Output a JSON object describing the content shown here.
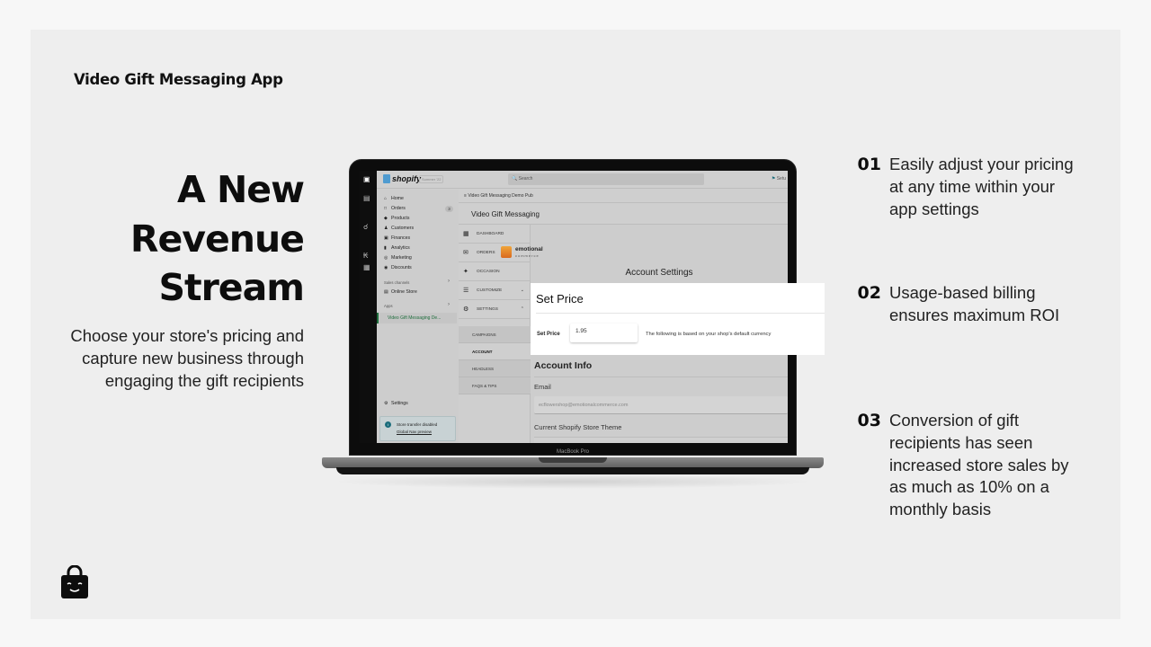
{
  "slide": {
    "app_title": "Video Gift Messaging App",
    "headline_lines": [
      "A New",
      "Revenue",
      "Stream"
    ],
    "subtext_lines": [
      "Choose your store's pricing and",
      "capture new business through",
      "engaging the gift recipients"
    ],
    "logo_icon": "smiling-shopping-bag-icon"
  },
  "features": [
    {
      "num": "01",
      "lines": [
        "Easily adjust your pricing",
        "at any time within your",
        "app settings"
      ]
    },
    {
      "num": "02",
      "lines": [
        "Usage-based billing",
        "ensures maximum ROI"
      ]
    },
    {
      "num": "03",
      "lines": [
        "Conversion of gift",
        "recipients has seen",
        "increased store sales by",
        "as much as 10% on a",
        "monthly basis"
      ]
    }
  ],
  "laptop": {
    "label": "MacBook Pro",
    "shopify": {
      "brand": "shopify",
      "edition_badge": "Summer '22",
      "search_placeholder": "Search",
      "setup_label": "Setu",
      "nav": [
        {
          "label": "Home",
          "icon": "home-icon"
        },
        {
          "label": "Orders",
          "icon": "orders-icon",
          "badge": "3"
        },
        {
          "label": "Products",
          "icon": "tag-icon"
        },
        {
          "label": "Customers",
          "icon": "person-icon"
        },
        {
          "label": "Finances",
          "icon": "bank-icon"
        },
        {
          "label": "Analytics",
          "icon": "bar-chart-icon"
        },
        {
          "label": "Marketing",
          "icon": "target-icon"
        },
        {
          "label": "Discounts",
          "icon": "discount-icon"
        }
      ],
      "sales_channels_label": "Sales channels",
      "online_store_label": "Online Store",
      "apps_label": "Apps",
      "active_app": "Video Gift Messaging De...",
      "settings_label": "Settings",
      "banner_line1": "Store transfer disabled",
      "banner_line2": "Global Nav preview",
      "breadcrumb": "Video Gift Messaging Demo Pub",
      "app_header": "Video Gift Messaging",
      "sub_nav": [
        {
          "label": "DASHBOARD",
          "icon": "dashboard-icon"
        },
        {
          "label": "ORDERS",
          "icon": "orders-box-icon"
        },
        {
          "label": "OCCASION",
          "icon": "party-icon"
        },
        {
          "label": "CUSTOMIZE",
          "icon": "sliders-icon",
          "chevron": "down"
        },
        {
          "label": "SETTINGS",
          "icon": "gear-icon",
          "chevron": "up"
        }
      ],
      "settings_children": [
        "CAMPAIGNS",
        "ACCOUNT",
        "HEADLESS",
        "FAQS & TIPS"
      ],
      "active_child": "ACCOUNT",
      "brand_logo_top": "emotional",
      "brand_logo_bottom": "commerce",
      "account_settings_title": "Account Settings",
      "account_info_title": "Account Info",
      "email_label": "Email",
      "email_value": "ecflowershop@emotionalcommerce.com",
      "theme_label": "Current Shopify Store Theme"
    }
  },
  "price_card": {
    "title": "Set Price",
    "field_label": "Set Price",
    "field_value": "1.95",
    "note": "The following is based on your shop's default currency"
  }
}
